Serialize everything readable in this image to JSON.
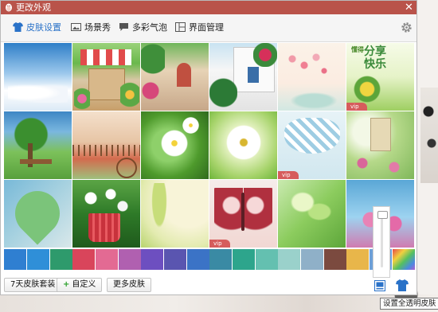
{
  "window": {
    "title": "更改外观",
    "close_symbol": "✕",
    "accent": "#b9534a"
  },
  "tabs": [
    {
      "label": "皮肤设置",
      "icon": "shirt-icon",
      "active": true
    },
    {
      "label": "场景秀",
      "icon": "picture-icon",
      "active": false
    },
    {
      "label": "多彩气泡",
      "icon": "speech-bubble-icon",
      "active": false
    },
    {
      "label": "界面管理",
      "icon": "layout-icon",
      "active": false
    }
  ],
  "thumbnails": [
    {
      "name": "sky-clouds",
      "vip": false
    },
    {
      "name": "garden-balcony",
      "vip": false
    },
    {
      "name": "flower-street",
      "vip": false
    },
    {
      "name": "white-house",
      "vip": false
    },
    {
      "name": "pink-blossom",
      "vip": false
    },
    {
      "name": "share-happiness",
      "vip": true,
      "text_line1": "分享",
      "text_line2": "快乐",
      "small_text": "懂得"
    },
    {
      "name": "park-bench",
      "vip": false
    },
    {
      "name": "bicycle-fence",
      "vip": false
    },
    {
      "name": "white-flowers-green",
      "vip": false
    },
    {
      "name": "white-flower-closeup",
      "vip": false
    },
    {
      "name": "gingham-bow",
      "vip": true
    },
    {
      "name": "church-bokeh",
      "vip": false
    },
    {
      "name": "green-heart-leaf",
      "vip": false
    },
    {
      "name": "teacup-flowers",
      "vip": false
    },
    {
      "name": "cream-flower",
      "vip": false
    },
    {
      "name": "butterfly",
      "vip": true
    },
    {
      "name": "green-sprout",
      "vip": false
    },
    {
      "name": "pink-tulips",
      "vip": false
    }
  ],
  "swatch_colors": [
    "#2f7fd1",
    "#2f8fd8",
    "#2e9a6c",
    "#d9455b",
    "#e36a93",
    "#b060b0",
    "#6d4fc0",
    "#5a55b0",
    "#3b73c6",
    "#3a8aa4",
    "#2da58c",
    "#64c0b0",
    "#9ad1cb",
    "#8fb0c8",
    "#7b4a3f",
    "#e8b64a",
    "#6da0d8",
    "#d8d070"
  ],
  "slider": {
    "level_percent": 100
  },
  "buttons": {
    "pack": "7天皮肤套装",
    "custom_plus": "+",
    "custom": "自定义",
    "more": "更多皮肤"
  },
  "tooltip": "设置全透明皮肤"
}
